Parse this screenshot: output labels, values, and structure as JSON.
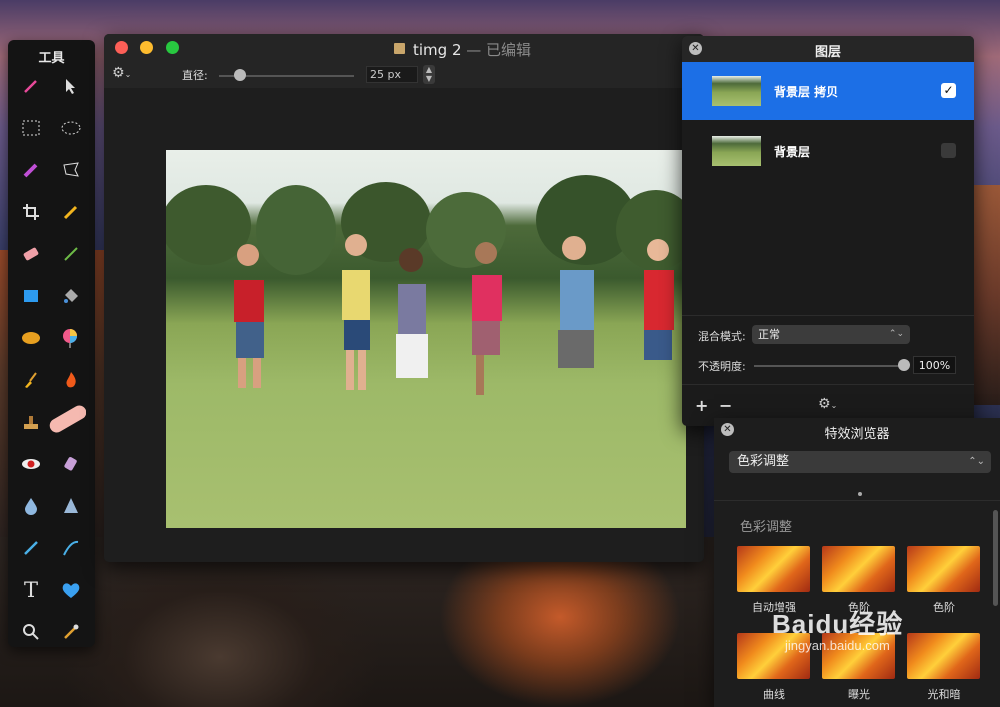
{
  "tools_panel": {
    "title": "工具"
  },
  "document_window": {
    "title": "timg 2",
    "edited_suffix": " — 已编辑",
    "diameter_label": "直径:",
    "diameter_value": "25 px"
  },
  "layers_panel": {
    "title": "图层",
    "layers": [
      {
        "name": "背景层 拷贝",
        "visible": true,
        "selected": true
      },
      {
        "name": "背景层",
        "visible": false,
        "selected": false
      }
    ],
    "blend_label": "混合模式:",
    "blend_value": "正常",
    "opacity_label": "不透明度:",
    "opacity_value": "100%"
  },
  "effects_panel": {
    "title": "特效浏览器",
    "category": "色彩调整",
    "section_title": "色彩调整",
    "effects": [
      {
        "label": "自动增强"
      },
      {
        "label": "色阶"
      },
      {
        "label": "色阶"
      },
      {
        "label": "曲线"
      },
      {
        "label": "曝光"
      },
      {
        "label": "光和暗"
      }
    ]
  },
  "watermark": {
    "text": "Baidu经验",
    "url": "jingyan.baidu.com"
  }
}
